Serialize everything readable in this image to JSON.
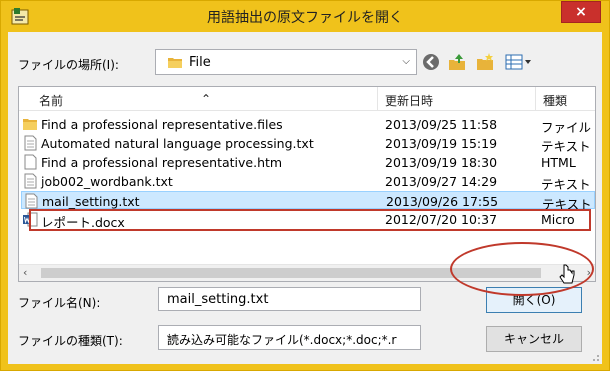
{
  "window": {
    "title": "用語抽出の原文ファイルを開く",
    "close_label": "×"
  },
  "location": {
    "label": "ファイルの場所(I):",
    "value": "File"
  },
  "columns": {
    "name": "名前",
    "date": "更新日時",
    "type": "種類"
  },
  "files": [
    {
      "name": "Find a professional representative.files",
      "date": "2013/09/25 11:58",
      "type": "ファイル",
      "icon": "folder-icon"
    },
    {
      "name": "Automated natural language processing.txt",
      "date": "2013/09/19 15:19",
      "type": "テキスト",
      "icon": "text-file-icon"
    },
    {
      "name": "Find a professional representative.htm",
      "date": "2013/09/19 18:30",
      "type": "HTML",
      "icon": "html-file-icon"
    },
    {
      "name": "job002_wordbank.txt",
      "date": "2013/09/27 14:29",
      "type": "テキスト",
      "icon": "text-file-icon"
    },
    {
      "name": "mail_setting.txt",
      "date": "2013/09/26 17:55",
      "type": "テキスト",
      "icon": "text-file-icon",
      "selected": true
    },
    {
      "name": "レポート.docx",
      "date": "2012/07/20 10:37",
      "type": "Micro",
      "icon": "word-file-icon"
    }
  ],
  "filename": {
    "label": "ファイル名(N):",
    "value": "mail_setting.txt"
  },
  "filetype": {
    "label": "ファイルの種類(T):",
    "value": "読み込み可能なファイル(*.docx;*.doc;*.rtf;*.h"
  },
  "buttons": {
    "open": "開く(O)",
    "cancel": "キャンセル"
  },
  "colors": {
    "titlebar": "#f0c21b",
    "close": "#c9302c",
    "highlight": "#c0392b",
    "selection": "#cce8ff"
  }
}
